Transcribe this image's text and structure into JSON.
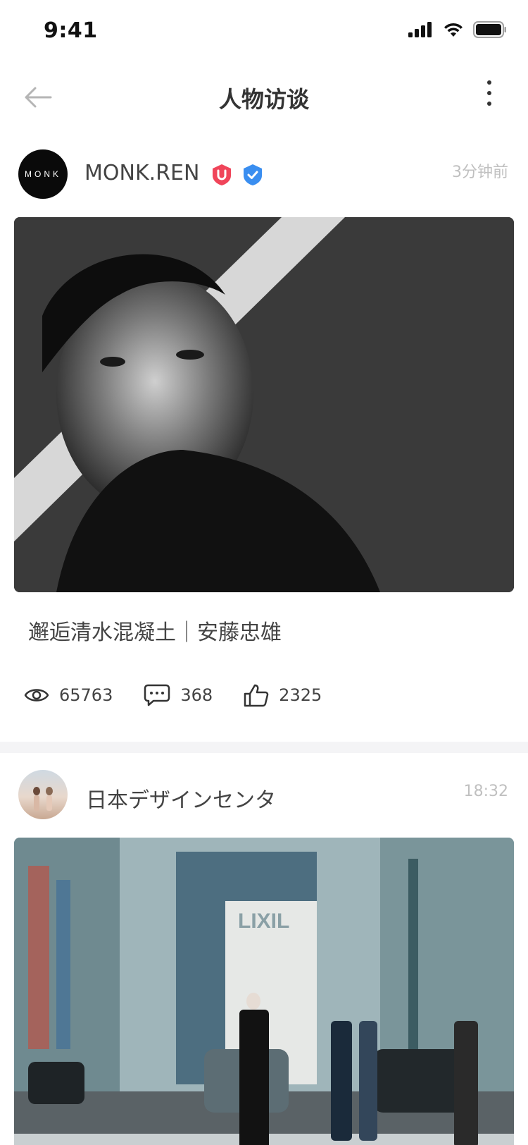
{
  "status_bar": {
    "time": "9:41"
  },
  "nav": {
    "title": "人物访谈"
  },
  "posts": [
    {
      "author": "MONK.REN",
      "avatar_text": "MONK",
      "time": "3分钟前",
      "title": "邂逅清水混凝土｜安藤忠雄",
      "stats": {
        "views": "65763",
        "comments": "368",
        "likes": "2325"
      },
      "badges": [
        "u-badge-icon",
        "verified-icon"
      ]
    },
    {
      "author": "日本デザインセンタ",
      "time": "18:32",
      "sign_text": "LIXIL"
    }
  ],
  "colors": {
    "u_badge": "#f0455a",
    "verified": "#3a8ef0",
    "divider": "#f4f4f6"
  }
}
